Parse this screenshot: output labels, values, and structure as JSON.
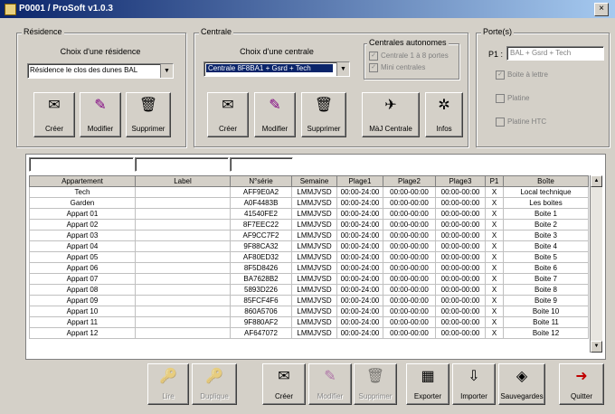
{
  "window": {
    "title": "P0001 / ProSoft v1.0.3",
    "close": "×"
  },
  "residence": {
    "group_label": "Résidence",
    "choice_label": "Choix d'une résidence",
    "combo_value": "Résidence le clos des dunes BAL",
    "buttons": {
      "create": "Créer",
      "modify": "Modifier",
      "delete": "Supprimer"
    }
  },
  "centrale": {
    "group_label": "Centrale",
    "choice_label": "Choix d'une centrale",
    "combo_value": "Centrale 8F8BA1 + Gsrd + Tech",
    "buttons": {
      "create": "Créer",
      "modify": "Modifier",
      "delete": "Supprimer",
      "update": "MàJ Centrale",
      "info": "Infos"
    },
    "autonomous": {
      "label": "Centrales autonomes",
      "items": [
        "Centrale 1 à 8 portes",
        "Mini centrales"
      ]
    }
  },
  "portes": {
    "group_label": "Porte(s)",
    "p1_label": "P1 :",
    "p1_value": "BAL + Gsrd + Tech",
    "options": [
      "Boite à lettre",
      "Platine",
      "Platine HTC"
    ]
  },
  "filters": [
    "",
    "",
    ""
  ],
  "table": {
    "columns": [
      "Appartement",
      "Label",
      "N°série",
      "Semaine",
      "Plage1",
      "Plage2",
      "Plage3",
      "P1",
      "Boîte"
    ],
    "rows": [
      [
        "Tech",
        "",
        "AFF9E0A2",
        "LMMJVSD",
        "00:00-24:00",
        "00:00-00:00",
        "00:00-00:00",
        "X",
        "Local technique"
      ],
      [
        "Garden",
        "",
        "A0F4483B",
        "LMMJVSD",
        "00:00-24:00",
        "00:00-00:00",
        "00:00-00:00",
        "X",
        "Les boites"
      ],
      [
        "Appart 01",
        "",
        "41540FE2",
        "LMMJVSD",
        "00:00-24:00",
        "00:00-00:00",
        "00:00-00:00",
        "X",
        "Boite 1"
      ],
      [
        "Appart 02",
        "",
        "8F7EEC22",
        "LMMJVSD",
        "00:00-24:00",
        "00:00-00:00",
        "00:00-00:00",
        "X",
        "Boite 2"
      ],
      [
        "Appart 03",
        "",
        "AF9CC7F2",
        "LMMJVSD",
        "00:00-24:00",
        "00:00-00:00",
        "00:00-00:00",
        "X",
        "Boite 3"
      ],
      [
        "Appart 04",
        "",
        "9F88CA32",
        "LMMJVSD",
        "00:00-24:00",
        "00:00-00:00",
        "00:00-00:00",
        "X",
        "Boite 4"
      ],
      [
        "Appart 05",
        "",
        "AF80ED32",
        "LMMJVSD",
        "00:00-24:00",
        "00:00-00:00",
        "00:00-00:00",
        "X",
        "Boite 5"
      ],
      [
        "Appart 06",
        "",
        "8F5D8426",
        "LMMJVSD",
        "00:00-24:00",
        "00:00-00:00",
        "00:00-00:00",
        "X",
        "Boite 6"
      ],
      [
        "Appart 07",
        "",
        "BA7628B2",
        "LMMJVSD",
        "00:00-24:00",
        "00:00-00:00",
        "00:00-00:00",
        "X",
        "Boite 7"
      ],
      [
        "Appart 08",
        "",
        "5893D226",
        "LMMJVSD",
        "00:00-24:00",
        "00:00-00:00",
        "00:00-00:00",
        "X",
        "Boite 8"
      ],
      [
        "Appart 09",
        "",
        "85FCF4F6",
        "LMMJVSD",
        "00:00-24:00",
        "00:00-00:00",
        "00:00-00:00",
        "X",
        "Boite 9"
      ],
      [
        "Appart 10",
        "",
        "860A5706",
        "LMMJVSD",
        "00:00-24:00",
        "00:00-00:00",
        "00:00-00:00",
        "X",
        "Boite 10"
      ],
      [
        "Appart 11",
        "",
        "9F880AF2",
        "LMMJVSD",
        "00:00-24:00",
        "00:00-00:00",
        "00:00-00:00",
        "X",
        "Boite 11"
      ],
      [
        "Appart 12",
        "",
        "AF647072",
        "LMMJVSD",
        "00:00-24:00",
        "00:00-00:00",
        "00:00-00:00",
        "X",
        "Boite 12"
      ]
    ]
  },
  "bottom_buttons": {
    "read": "Lire",
    "duplicate": "Duplique",
    "create": "Créer",
    "modify": "Modifier",
    "delete": "Supprimer",
    "export": "Exporter",
    "import": "Importer",
    "save": "Sauvegardes",
    "quit": "Quitter"
  },
  "colors": {
    "titlebar": "#0a246a",
    "face": "#d4d0c8",
    "selection": "#0a246a"
  },
  "icons": {
    "create": "create-icon",
    "modify": "pencil-icon",
    "delete": "trash-icon",
    "update": "remote-icon",
    "info": "info-icon",
    "read": "key-read-icon",
    "duplicate": "key-duplicate-icon",
    "export": "export-icon",
    "import": "import-icon",
    "save": "save-icon",
    "quit": "quit-icon"
  }
}
